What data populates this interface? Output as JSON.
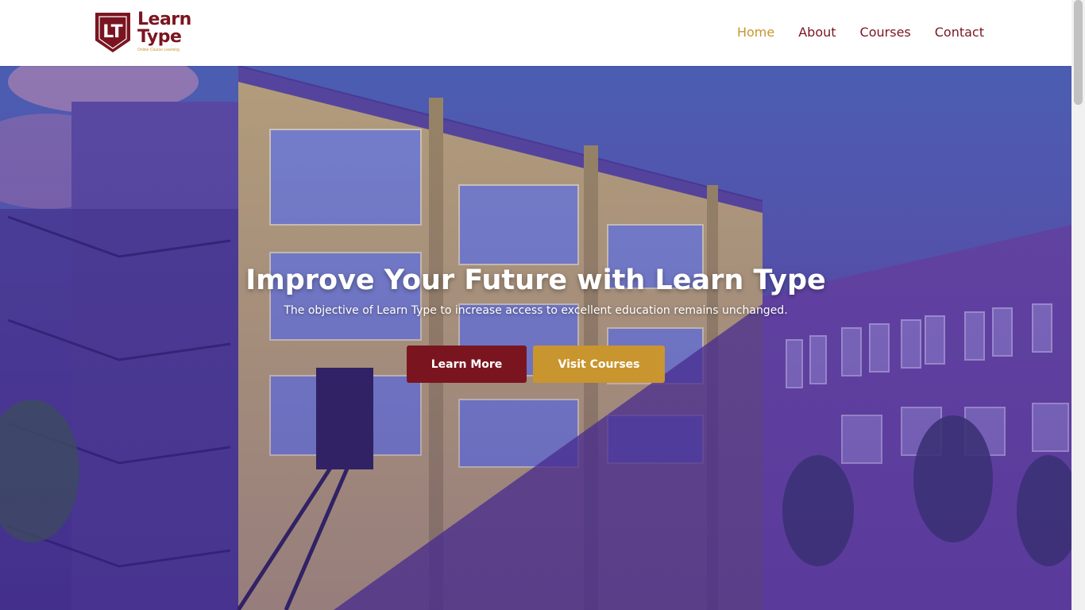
{
  "brand": {
    "mark": "LT",
    "name_line1": "Learn",
    "name_line2": "Type",
    "tagline": "Online Course Learning",
    "colors": {
      "primary": "#7a1520",
      "accent": "#c9952e"
    }
  },
  "nav": {
    "items": [
      {
        "label": "Home",
        "active": true
      },
      {
        "label": "About",
        "active": false
      },
      {
        "label": "Courses",
        "active": false
      },
      {
        "label": "Contact",
        "active": false
      }
    ]
  },
  "hero": {
    "title": "Improve Your Future with Learn Type",
    "subtitle": "The objective of Learn Type to increase access to excellent education remains unchanged.",
    "buttons": {
      "learn_more": "Learn More",
      "visit_courses": "Visit Courses"
    }
  }
}
